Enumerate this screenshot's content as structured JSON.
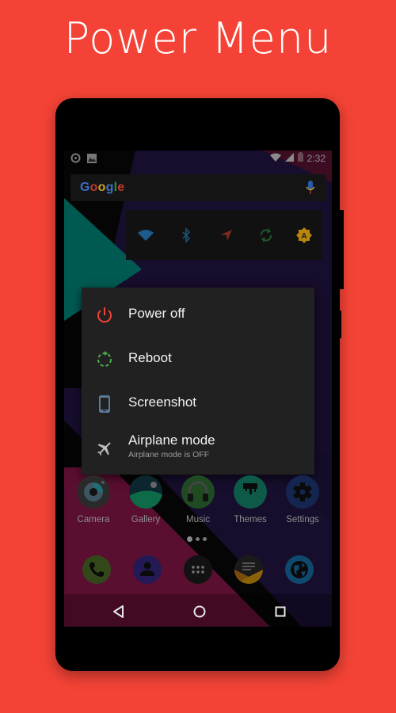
{
  "headline": "Power Menu",
  "colors": {
    "background": "#f44336",
    "power_red": "#f44336",
    "reboot_green": "#4caf50",
    "screenshot_blue": "#5a7a96",
    "airplane_gray": "#bdbdbd"
  },
  "status_bar": {
    "left_icons": [
      "music-sync-icon",
      "image-icon"
    ],
    "right_icons": [
      "wifi-icon",
      "signal-icon",
      "battery-icon"
    ],
    "time": "2:32"
  },
  "search_widget": {
    "logo_letters": [
      "G",
      "o",
      "o",
      "g",
      "l",
      "e"
    ],
    "logo_colors": [
      "#3b6fc7",
      "#c0392b",
      "#c9a227",
      "#3b6fc7",
      "#2e8b46",
      "#c0392b"
    ],
    "mic_icon": "mic-icon"
  },
  "quick_settings": [
    {
      "icon": "wifi-icon",
      "color": "#1e5a8a"
    },
    {
      "icon": "bluetooth-icon",
      "color": "#1e4e70"
    },
    {
      "icon": "location-icon",
      "color": "#7a2a22"
    },
    {
      "icon": "sync-icon",
      "color": "#1f5a2a"
    },
    {
      "icon": "auto-brightness-icon",
      "color": "#b8860b"
    }
  ],
  "power_menu": {
    "items": [
      {
        "label": "Power off",
        "icon": "power-icon"
      },
      {
        "label": "Reboot",
        "icon": "reboot-icon"
      },
      {
        "label": "Screenshot",
        "icon": "phone-screenshot-icon"
      },
      {
        "label": "Airplane mode",
        "sublabel": "Airplane mode is OFF",
        "icon": "airplane-icon"
      }
    ]
  },
  "apps": [
    {
      "name": "Camera",
      "icon": "camera-icon"
    },
    {
      "name": "Gallery",
      "icon": "gallery-icon"
    },
    {
      "name": "Music",
      "icon": "headphones-icon"
    },
    {
      "name": "Themes",
      "icon": "themes-icon"
    },
    {
      "name": "Settings",
      "icon": "gear-icon"
    }
  ],
  "page_indicator": {
    "pages": 3,
    "current": 1
  },
  "dock": [
    {
      "name": "Phone",
      "icon": "phone-icon"
    },
    {
      "name": "Contacts",
      "icon": "contact-icon"
    },
    {
      "name": "App drawer",
      "icon": "app-drawer-icon"
    },
    {
      "name": "Messages",
      "icon": "message-icon"
    },
    {
      "name": "Browser",
      "icon": "globe-icon"
    }
  ],
  "nav_bar": {
    "back": "back-icon",
    "home": "home-icon",
    "recents": "recents-icon"
  }
}
